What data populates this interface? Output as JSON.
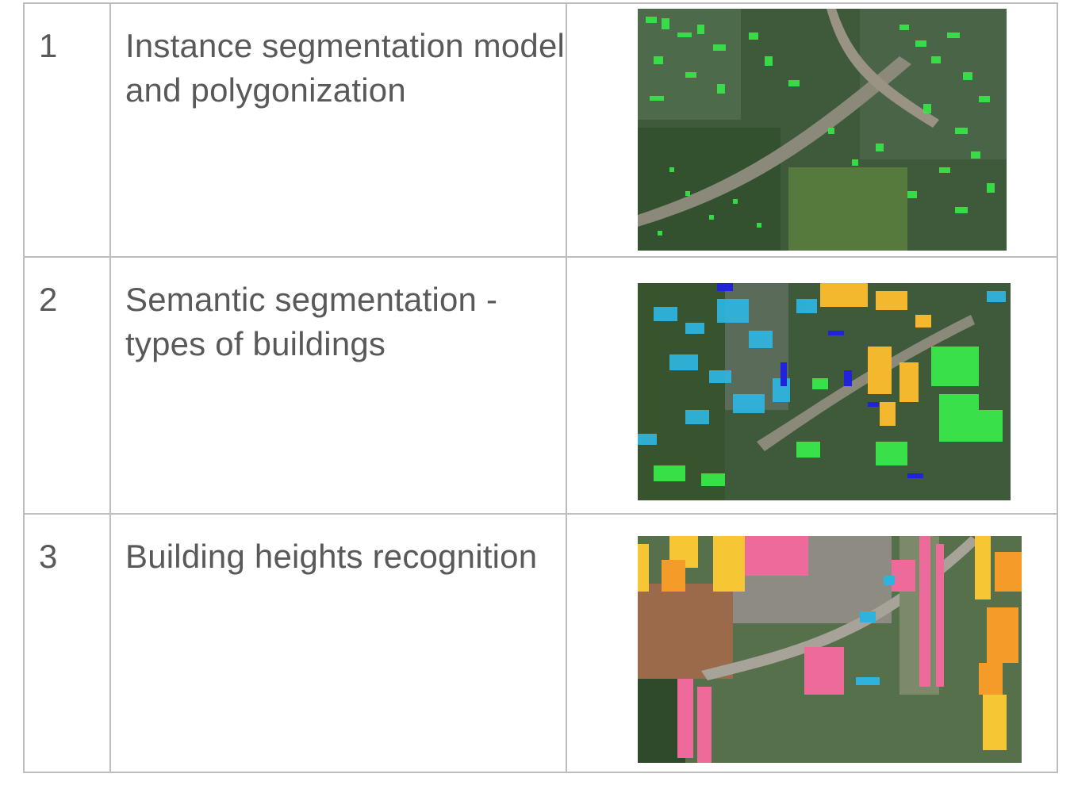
{
  "rows": [
    {
      "number": "1",
      "description": "Instance segmentation model and polygonization"
    },
    {
      "number": "2",
      "description": "Semantic segmentation - types of buildings"
    },
    {
      "number": "3",
      "description": "Building heights recognition"
    }
  ],
  "colors": {
    "border": "#bdbdbd",
    "text": "#595959",
    "instance_green": "#39e84a",
    "semantic_cyan": "#2fb3dd",
    "semantic_blue": "#2222dd",
    "semantic_yellow": "#f3b82d",
    "height_pink": "#ee6a9a",
    "height_yellow": "#f7c634",
    "height_orange": "#f59b2a"
  }
}
